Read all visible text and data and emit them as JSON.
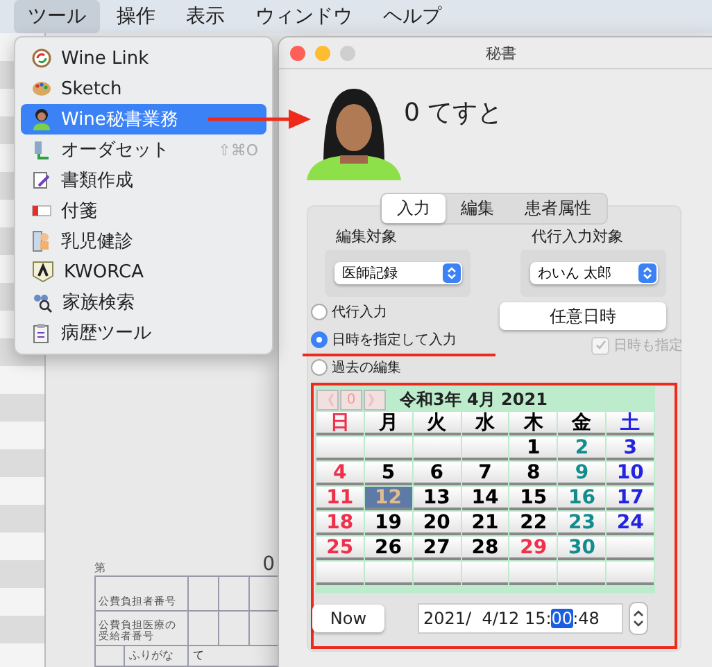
{
  "menubar": [
    {
      "label": "ツール",
      "selected": true
    },
    {
      "label": "操作",
      "selected": false
    },
    {
      "label": "表示",
      "selected": false
    },
    {
      "label": "ウィンドウ",
      "selected": false
    },
    {
      "label": "ヘルプ",
      "selected": false
    }
  ],
  "tool_menu": [
    {
      "label": "Wine Link",
      "selected": false
    },
    {
      "label": "Sketch",
      "selected": false
    },
    {
      "label": "Wine秘書業務",
      "selected": true
    },
    {
      "label": "オーダセット",
      "selected": false,
      "shortcut": "⇧⌘O"
    },
    {
      "label": "書類作成",
      "selected": false
    },
    {
      "label": "付箋",
      "selected": false
    },
    {
      "label": "乳児健診",
      "selected": false
    },
    {
      "label": "KWORCA",
      "selected": false
    },
    {
      "label": "家族検索",
      "selected": false
    },
    {
      "label": "病歴ツール",
      "selected": false
    }
  ],
  "background_form": {
    "number_label": "第",
    "number": "0",
    "rows": [
      {
        "label": "公費負担者番号"
      },
      {
        "label": "公費負担医療の受給者番号"
      }
    ],
    "furigana_label": "ふりがな",
    "furigana_value": "て"
  },
  "secretary_window": {
    "title": "秘書",
    "patient_name": "0 てすと",
    "tabs": [
      {
        "label": "入力",
        "selected": true
      },
      {
        "label": "編集",
        "selected": false
      },
      {
        "label": "患者属性",
        "selected": false
      }
    ],
    "edit_target": {
      "label": "編集対象",
      "value": "医師記録"
    },
    "proxy_target": {
      "label": "代行入力対象",
      "value": "わいん 太郎"
    },
    "radios": [
      {
        "label": "代行入力",
        "selected": false
      },
      {
        "label": "日時を指定して入力",
        "selected": true
      },
      {
        "label": "過去の編集",
        "selected": false
      }
    ],
    "date_button": "任意日時",
    "datetime_checkbox": {
      "label": "日時も指定",
      "checked": true,
      "disabled": true
    },
    "calendar": {
      "nav": [
        "《",
        "0",
        "》"
      ],
      "title": "令和3年 4月 2021",
      "weekdays": [
        {
          "label": "日",
          "color": "#f0304a"
        },
        {
          "label": "月",
          "color": "#000000"
        },
        {
          "label": "火",
          "color": "#000000"
        },
        {
          "label": "水",
          "color": "#000000"
        },
        {
          "label": "木",
          "color": "#000000"
        },
        {
          "label": "金",
          "color": "#000000"
        },
        {
          "label": "土",
          "color": "#2424e0"
        }
      ],
      "weeks": [
        [
          {
            "kind": "empty"
          },
          {
            "kind": "empty"
          },
          {
            "kind": "empty"
          },
          {
            "kind": "empty"
          },
          {
            "day": "1",
            "color": "#000000",
            "selected": false
          },
          {
            "day": "2",
            "color": "#128c8c",
            "selected": false
          },
          {
            "day": "3",
            "color": "#2424e0",
            "selected": false
          }
        ],
        [
          {
            "day": "4",
            "color": "#f0304a",
            "selected": false
          },
          {
            "day": "5",
            "color": "#000000",
            "selected": false
          },
          {
            "day": "6",
            "color": "#000000",
            "selected": false
          },
          {
            "day": "7",
            "color": "#000000",
            "selected": false
          },
          {
            "day": "8",
            "color": "#000000",
            "selected": false
          },
          {
            "day": "9",
            "color": "#128c8c",
            "selected": false
          },
          {
            "day": "10",
            "color": "#2424e0",
            "selected": false
          }
        ],
        [
          {
            "day": "11",
            "color": "#f0304a",
            "selected": false
          },
          {
            "day": "12",
            "selected": true
          },
          {
            "day": "13",
            "color": "#000000",
            "selected": false
          },
          {
            "day": "14",
            "color": "#000000",
            "selected": false
          },
          {
            "day": "15",
            "color": "#000000",
            "selected": false
          },
          {
            "day": "16",
            "color": "#128c8c",
            "selected": false
          },
          {
            "day": "17",
            "color": "#2424e0",
            "selected": false
          }
        ],
        [
          {
            "day": "18",
            "color": "#f0304a",
            "selected": false
          },
          {
            "day": "19",
            "color": "#000000",
            "selected": false
          },
          {
            "day": "20",
            "color": "#000000",
            "selected": false
          },
          {
            "day": "21",
            "color": "#000000",
            "selected": false
          },
          {
            "day": "22",
            "color": "#000000",
            "selected": false
          },
          {
            "day": "23",
            "color": "#128c8c",
            "selected": false
          },
          {
            "day": "24",
            "color": "#2424e0",
            "selected": false
          }
        ],
        [
          {
            "day": "25",
            "color": "#f0304a",
            "selected": false
          },
          {
            "day": "26",
            "color": "#000000",
            "selected": false
          },
          {
            "day": "27",
            "color": "#000000",
            "selected": false
          },
          {
            "day": "28",
            "color": "#000000",
            "selected": false
          },
          {
            "day": "29",
            "color": "#f0304a",
            "selected": false
          },
          {
            "day": "30",
            "color": "#128c8c",
            "selected": false
          },
          {
            "kind": "empty"
          }
        ],
        [
          {
            "kind": "empty"
          },
          {
            "kind": "empty"
          },
          {
            "kind": "empty"
          },
          {
            "kind": "empty"
          },
          {
            "kind": "empty"
          },
          {
            "kind": "empty"
          },
          {
            "kind": "empty"
          }
        ]
      ]
    },
    "now_button": "Now",
    "datetime_field": {
      "before": "2021/  4/12 15:",
      "highlighted": "00",
      "after": ":48"
    }
  }
}
